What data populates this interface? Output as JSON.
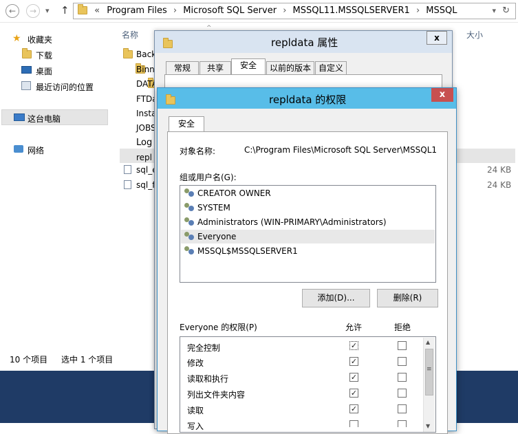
{
  "address": {
    "prefix": "«",
    "crumbs": [
      "Program Files",
      "Microsoft SQL Server",
      "MSSQL11.MSSQLSERVER1",
      "MSSQL"
    ],
    "sep": "›"
  },
  "nav": {
    "back": "←",
    "forward": "→",
    "up": "↑",
    "dropdown": "▾",
    "refresh": "↻"
  },
  "sidebar": {
    "favorites": "收藏夹",
    "downloads": "下载",
    "desktop": "桌面",
    "recent": "最近访问的位置",
    "this_pc": "这台电脑",
    "network": "网络"
  },
  "columns": {
    "name": "名称",
    "size": "大小"
  },
  "files": [
    {
      "name": "Back",
      "type": "folder",
      "size": ""
    },
    {
      "name": "Binn",
      "type": "folder",
      "size": ""
    },
    {
      "name": "DATA",
      "type": "folder",
      "size": ""
    },
    {
      "name": "FTDa",
      "type": "folder",
      "size": ""
    },
    {
      "name": "Insta",
      "type": "folder",
      "size": ""
    },
    {
      "name": "JOBS",
      "type": "folder",
      "size": ""
    },
    {
      "name": "Log",
      "type": "folder",
      "size": ""
    },
    {
      "name": "repl",
      "type": "folder",
      "size": ""
    },
    {
      "name": "sql_e",
      "type": "file",
      "size": "24 KB"
    },
    {
      "name": "sql_f",
      "type": "file",
      "size": "24 KB"
    }
  ],
  "status": {
    "count": "10 个项目",
    "selected": "选中 1 个项目"
  },
  "props_dialog": {
    "title": "repldata 属性",
    "close": "x",
    "tabs": [
      "常规",
      "共享",
      "安全",
      "以前的版本",
      "自定义"
    ]
  },
  "perm_dialog": {
    "title": "repldata 的权限",
    "close": "x",
    "tab": "安全",
    "object_label": "对象名称:",
    "object_value": "C:\\Program Files\\Microsoft SQL Server\\MSSQL1",
    "groups_label": "组或用户名(G):",
    "users": [
      "CREATOR OWNER",
      "SYSTEM",
      "Administrators (WIN-PRIMARY\\Administrators)",
      "Everyone",
      "MSSQL$MSSQLSERVER1"
    ],
    "selected_user_index": 3,
    "add_button": "添加(D)...",
    "remove_button": "删除(R)",
    "perms_label": "Everyone 的权限(P)",
    "allow_header": "允许",
    "deny_header": "拒绝",
    "permissions": [
      {
        "name": "完全控制",
        "allow": true,
        "deny": false
      },
      {
        "name": "修改",
        "allow": true,
        "deny": false
      },
      {
        "name": "读取和执行",
        "allow": true,
        "deny": false
      },
      {
        "name": "列出文件夹内容",
        "allow": true,
        "deny": false
      },
      {
        "name": "读取",
        "allow": true,
        "deny": false
      },
      {
        "name": "写入",
        "allow": true,
        "deny": false
      }
    ],
    "scroll_up": "▲",
    "scroll_down": "▼",
    "scroll_grip": "≡"
  }
}
